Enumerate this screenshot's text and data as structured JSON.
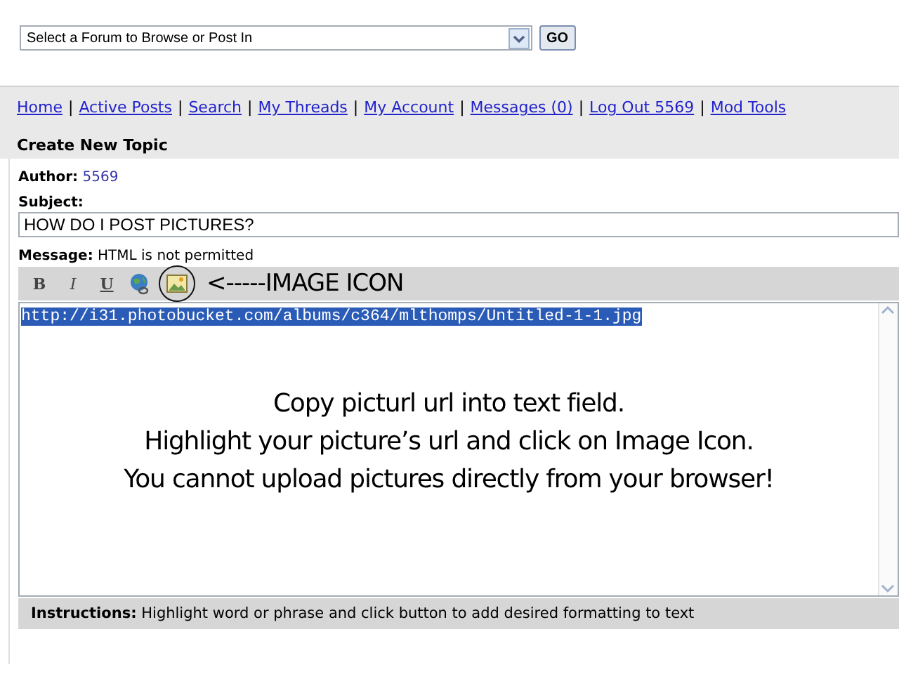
{
  "forum_select": {
    "value": "Select a Forum to Browse or Post In",
    "button": "GO"
  },
  "nav_links": [
    {
      "label": "Home"
    },
    {
      "separator": "|",
      "label": "Active Posts"
    },
    {
      "separator": "|",
      "label": "Search"
    },
    {
      "separator": "|",
      "label": "My Threads"
    },
    {
      "separator": "|",
      "label": "My Account"
    },
    {
      "separator": "|",
      "label": "Messages (0)"
    },
    {
      "separator": "|",
      "label": "Log Out 5569"
    },
    {
      "separator": "|",
      "label": "Mod Tools"
    }
  ],
  "section_title": "Create New Topic",
  "author": {
    "label": "Author:",
    "value": "5569"
  },
  "subject": {
    "label": "Subject:",
    "value": "HOW DO I POST PICTURES?"
  },
  "message": {
    "label": "Message:",
    "note": "HTML is not permitted"
  },
  "toolbar": [
    {
      "kind": "bold",
      "label": "B",
      "circled": false
    },
    {
      "kind": "italic",
      "label": "I",
      "circled": false
    },
    {
      "kind": "underline",
      "label": "U",
      "circled": false
    },
    {
      "kind": "link",
      "circled": false
    },
    {
      "kind": "image",
      "circled": true
    }
  ],
  "annotation": "<-----IMAGE ICON",
  "editor": {
    "selected_text": "http://i31.photobucket.com/albums/c364/mlthomps/Untitled-1-1.jpg",
    "overlay_lines": [
      "Copy picturl url into text field.",
      "Highlight your picture’s url and click on Image Icon.",
      "You cannot upload pictures directly from your browser!"
    ]
  },
  "instructions": {
    "label": "Instructions:",
    "text": "Highlight word or phrase and click button to add desired formatting to text"
  }
}
